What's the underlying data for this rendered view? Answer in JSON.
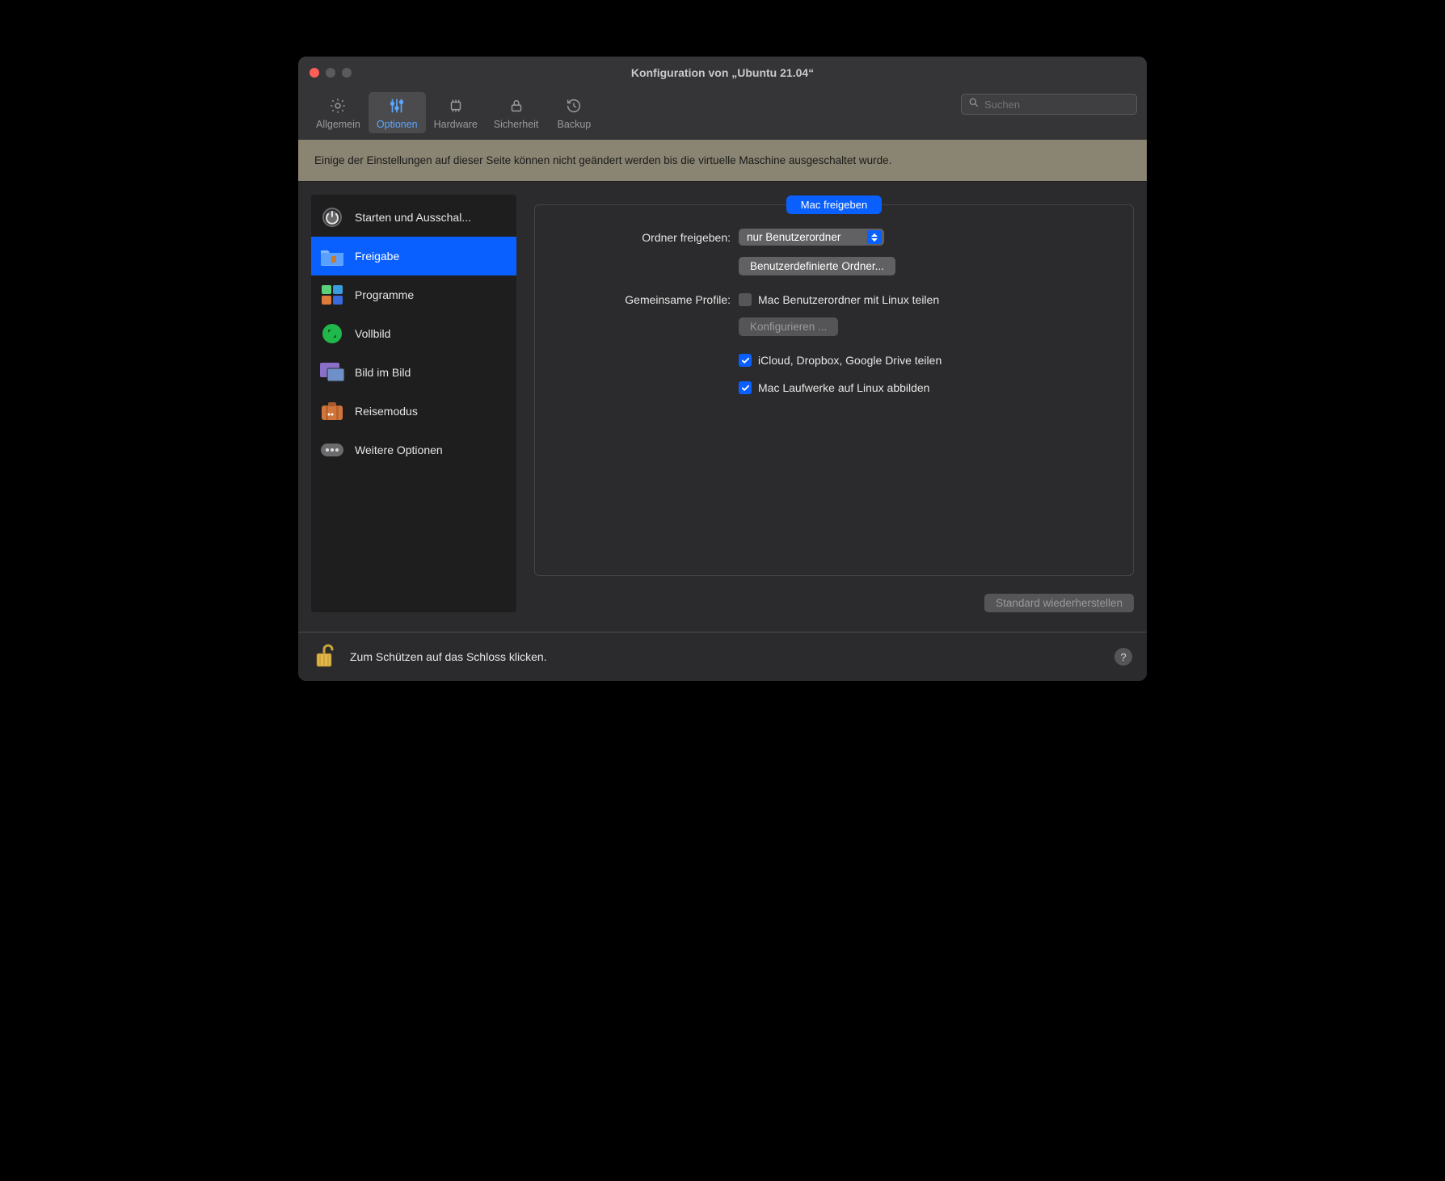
{
  "window": {
    "title": "Konfiguration von „Ubuntu  21.04“"
  },
  "toolbar": {
    "general": "Allgemein",
    "options": "Optionen",
    "hardware": "Hardware",
    "security": "Sicherheit",
    "backup": "Backup"
  },
  "search": {
    "placeholder": "Suchen"
  },
  "banner": "Einige der Einstellungen auf dieser Seite können nicht geändert werden bis die virtuelle Maschine ausgeschaltet wurde.",
  "sidebar": {
    "items": [
      {
        "label": "Starten und Ausschal..."
      },
      {
        "label": "Freigabe"
      },
      {
        "label": "Programme"
      },
      {
        "label": "Vollbild"
      },
      {
        "label": "Bild im Bild"
      },
      {
        "label": "Reisemodus"
      },
      {
        "label": "Weitere Optionen"
      }
    ],
    "selected_index": 1
  },
  "content": {
    "section_title": "Mac freigeben",
    "share_folders_label": "Ordner freigeben:",
    "share_folders_value": "nur Benutzerordner",
    "custom_folders_btn": "Benutzerdefinierte Ordner...",
    "shared_profiles_label": "Gemeinsame Profile:",
    "share_mac_home_label": "Mac Benutzerordner mit Linux teilen",
    "configure_btn": "Konfigurieren ...",
    "share_cloud_label": "iCloud, Dropbox, Google Drive teilen",
    "map_drives_label": "Mac Laufwerke auf Linux abbilden",
    "restore_defaults_btn": "Standard wiederherstellen"
  },
  "lockbar": {
    "text": "Zum Schützen auf das Schloss klicken."
  },
  "help": "?"
}
